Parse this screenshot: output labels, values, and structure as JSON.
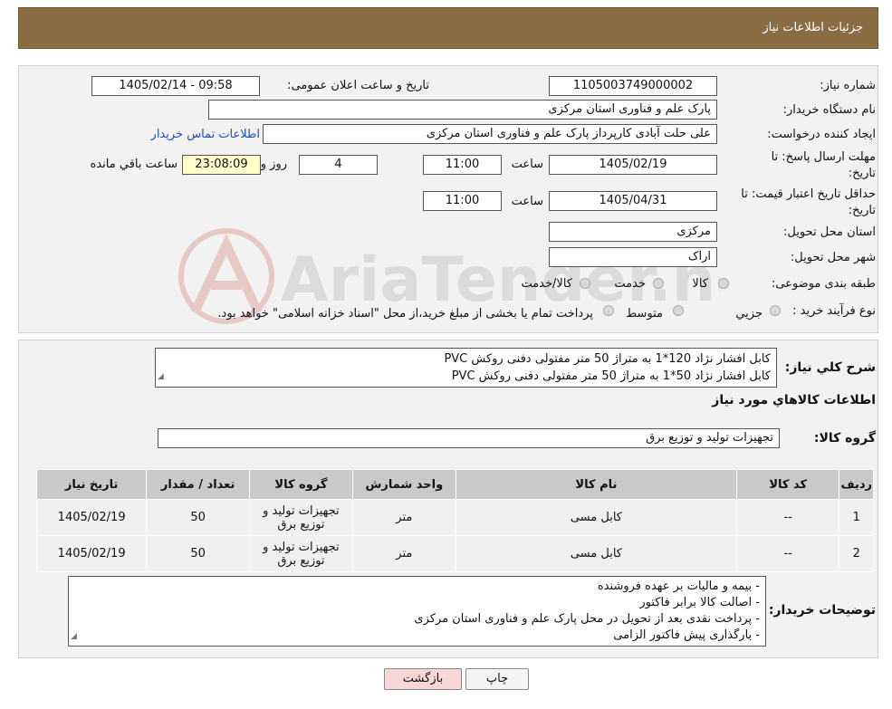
{
  "header": {
    "title": "جزئیات اطلاعات نیاز"
  },
  "fields": {
    "need_number_label": "شماره نیاز:",
    "need_number": "1105003749000002",
    "announce_label": "تاریخ و ساعت اعلان عمومی:",
    "announce_value": "1405/02/14 - 09:58",
    "buyer_org_label": "نام دستگاه خریدار:",
    "buyer_org": "پارک علم و فناوری استان مرکزی",
    "requester_label": "ایجاد کننده درخواست:",
    "requester": "علی حلت آبادی کارپرداز پارک علم و فناوری استان مرکزی",
    "contact_link": "اطلاعات تماس خریدار",
    "deadline_label_1": "مهلت ارسال پاسخ: تا",
    "deadline_label_2": "تاریخ:",
    "deadline_date": "1405/02/19",
    "hour_label": "ساعت",
    "deadline_time": "11:00",
    "days_value": "4",
    "days_label": "روز و",
    "remaining_time": "23:08:09",
    "remaining_label": "ساعت باقي مانده",
    "validity_label_1": "حداقل تاریخ اعتبار قیمت: تا",
    "validity_label_2": "تاریخ:",
    "validity_date": "1405/04/31",
    "validity_hour_label": "ساعت",
    "validity_time": "11:00",
    "province_label": "استان محل تحویل:",
    "province": "مرکزی",
    "city_label": "شهر محل تحویل:",
    "city": "اراک",
    "category_label": "طبقه بندی موضوعی:",
    "category_options": [
      "کالا",
      "خدمت",
      "کالا/خدمت"
    ],
    "process_label": "نوع فرآیند خرید :",
    "process_options": [
      "جزیي",
      "متوسط"
    ],
    "process_note": "پرداخت تمام یا بخشی از مبلغ خرید،از محل \"اسناد خزانه اسلامی\" خواهد بود."
  },
  "watermark": {
    "text": "AriaTender.neT"
  },
  "description": {
    "label": "شرح کلي نیاز:",
    "lines": [
      "کابل افشار نژاد 120*1 به متراژ 50 متر مفتولی دفنی روکش PVC",
      "کابل افشار نژاد 50*1 به متراژ 50 متر مفتولی دفنی روکش PVC"
    ]
  },
  "goods_section": {
    "title": "اطلاعات کالاهاي مورد نیاز",
    "group_label": "گروه کالا:",
    "group_value": "تجهیزات تولید و توزیع برق"
  },
  "table": {
    "headers": [
      "ردیف",
      "کد کالا",
      "نام کالا",
      "واحد شمارش",
      "گروه کالا",
      "تعداد / مقدار",
      "تاریخ نیاز"
    ],
    "rows": [
      {
        "row": "1",
        "code": "--",
        "name": "کابل مسی",
        "unit": "متر",
        "group": "تجهیزات تولید و توزیع برق",
        "qty": "50",
        "date": "1405/02/19"
      },
      {
        "row": "2",
        "code": "--",
        "name": "کابل مسی",
        "unit": "متر",
        "group": "تجهیزات تولید و توزیع برق",
        "qty": "50",
        "date": "1405/02/19"
      }
    ]
  },
  "buyer_notes": {
    "label": "توضیحات خریدار:",
    "lines": [
      "- بیمه و مالیات بر عهده فروشنده",
      "- اصالت کالا برابر فاکتور",
      "- پرداخت نقدی بعد از تحویل در محل پارک علم و فناوری استان مرکزی",
      "- بارگذاری پیش فاکتور الزامی"
    ]
  },
  "buttons": {
    "print": "چاپ",
    "back": "بازگشت"
  },
  "colors": {
    "header_bg": "#8b6d44",
    "back_button_bg": "#f8d7d7",
    "link": "#1a4fb8",
    "remaining_bg": "#ffffcc"
  }
}
